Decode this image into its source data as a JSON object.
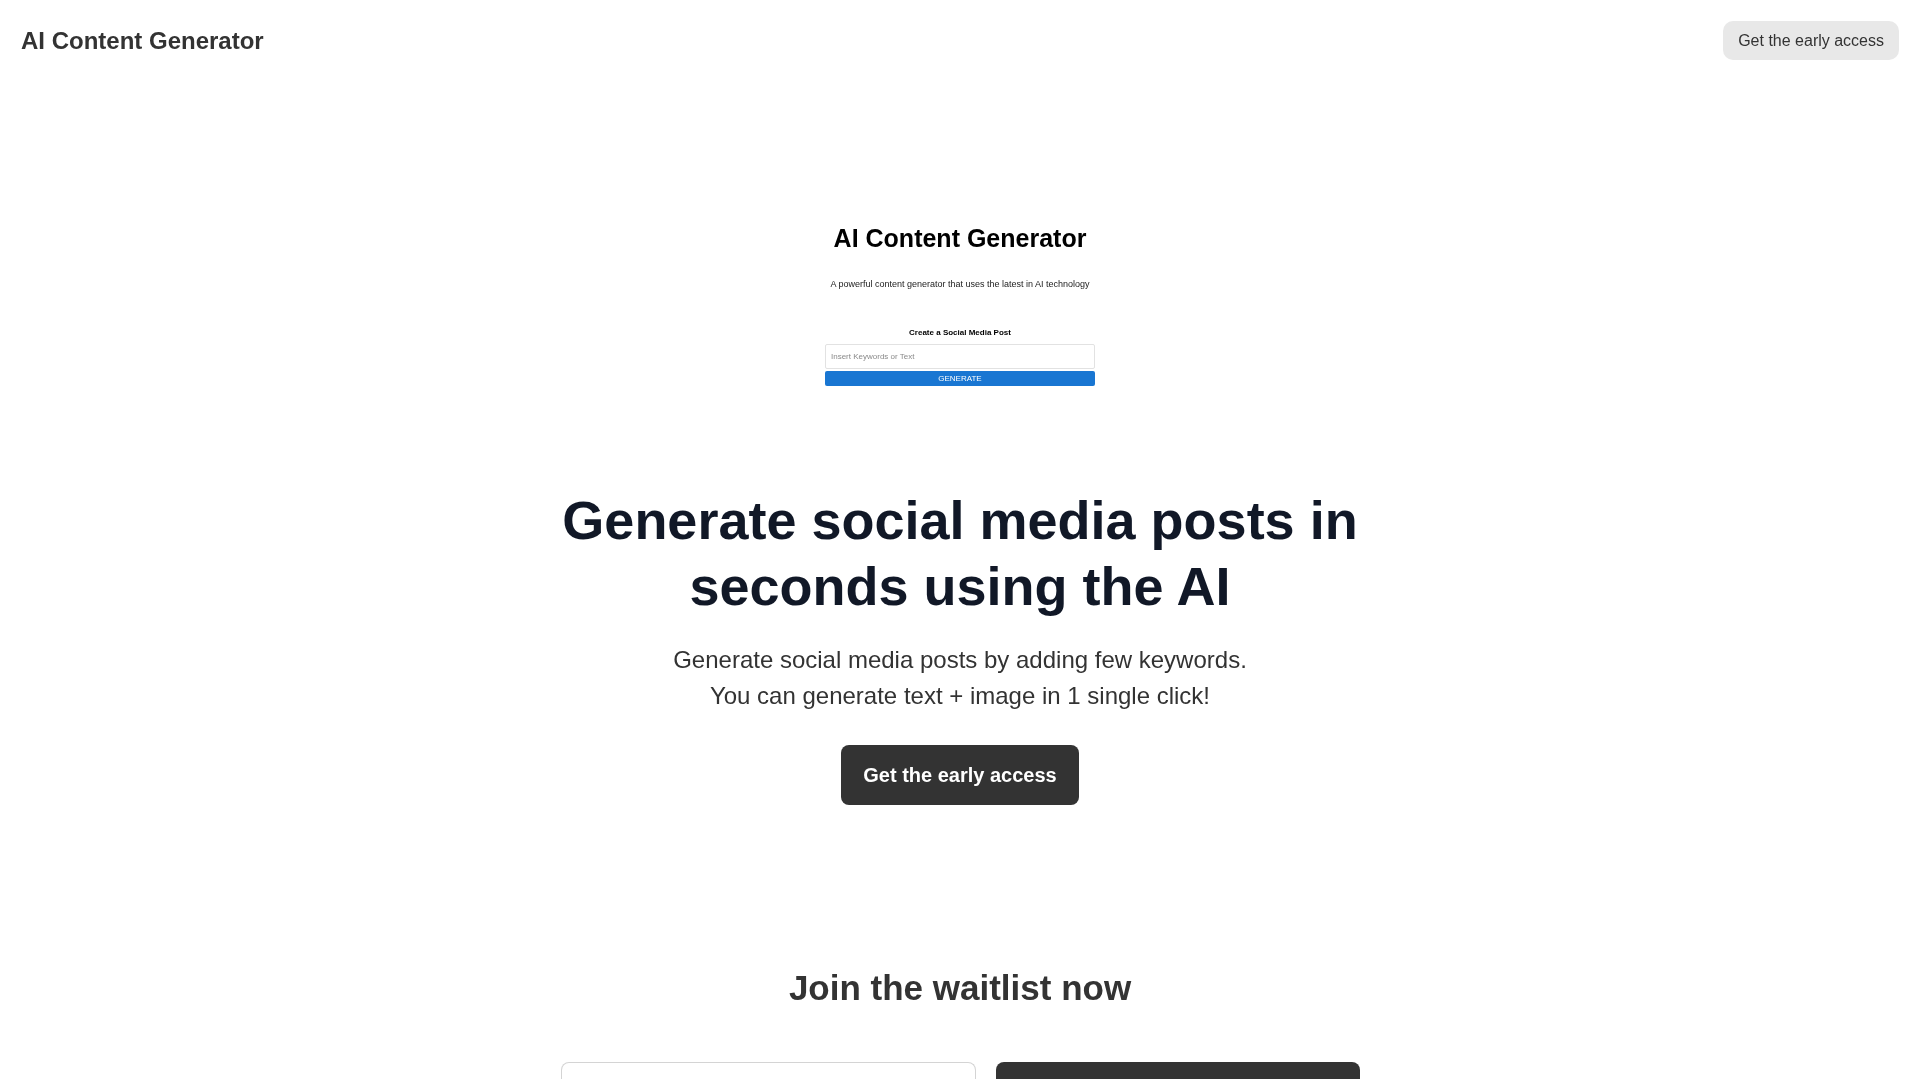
{
  "header": {
    "logo": "AI Content Generator",
    "button": "Get the early access"
  },
  "preview": {
    "title": "AI Content Generator",
    "subtitle": "A powerful content generator that uses the latest in AI technology",
    "form_title": "Create a Social Media Post",
    "input": {
      "placeholder": "Insert Keywords or Text"
    },
    "button": "GENERATE"
  },
  "hero": {
    "headline": "Generate social media posts in seconds using the AI",
    "description": "Generate social media posts by adding few keywords.\nYou can generate text + image in 1 single click!",
    "button": "Get the early access"
  },
  "waitlist": {
    "title": "Join the waitlist now"
  }
}
